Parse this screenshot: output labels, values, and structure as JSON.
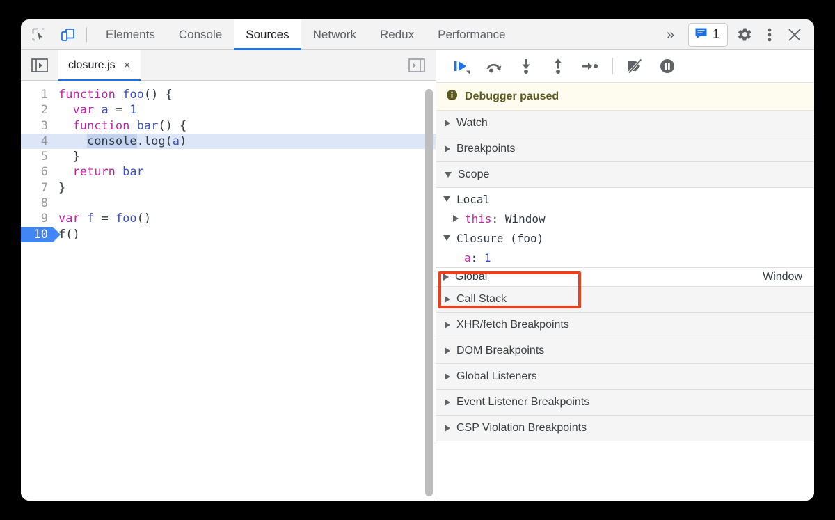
{
  "window": {
    "tabbar": {
      "inspect_icon": "inspect-element-icon",
      "device_icon": "device-toolbar-icon",
      "tabs": [
        {
          "label": "Elements",
          "active": false
        },
        {
          "label": "Console",
          "active": false
        },
        {
          "label": "Sources",
          "active": true
        },
        {
          "label": "Network",
          "active": false
        },
        {
          "label": "Redux",
          "active": false
        },
        {
          "label": "Performance",
          "active": false
        }
      ],
      "more_tabs_label": "»",
      "message_badge": {
        "icon": "message-bubble-icon",
        "count": "1"
      },
      "settings_icon": "gear-icon",
      "more_options_icon": "kebab-menu-icon",
      "close_icon": "close-icon"
    }
  },
  "editor": {
    "navigator_toggle_icon": "show-navigator-icon",
    "debugger_toggle_icon": "show-debugger-icon",
    "file_tab": {
      "name": "closure.js",
      "close_label": "×"
    },
    "lines": [
      {
        "n": "1",
        "breakpoint": false,
        "executing": false,
        "tokens": [
          {
            "t": "function",
            "c": "kw"
          },
          {
            "t": " ",
            "c": ""
          },
          {
            "t": "foo",
            "c": "fn"
          },
          {
            "t": "() {",
            "c": ""
          }
        ]
      },
      {
        "n": "2",
        "breakpoint": false,
        "executing": false,
        "tokens": [
          {
            "t": "  ",
            "c": ""
          },
          {
            "t": "var",
            "c": "kw"
          },
          {
            "t": " ",
            "c": ""
          },
          {
            "t": "a",
            "c": "vr"
          },
          {
            "t": " = ",
            "c": ""
          },
          {
            "t": "1",
            "c": "num"
          }
        ]
      },
      {
        "n": "3",
        "breakpoint": false,
        "executing": false,
        "tokens": [
          {
            "t": "  ",
            "c": ""
          },
          {
            "t": "function",
            "c": "kw"
          },
          {
            "t": " ",
            "c": ""
          },
          {
            "t": "bar",
            "c": "fn"
          },
          {
            "t": "() {",
            "c": ""
          }
        ]
      },
      {
        "n": "4",
        "breakpoint": false,
        "executing": true,
        "tokens": [
          {
            "t": "    ",
            "c": ""
          },
          {
            "t": "console",
            "c": "sel"
          },
          {
            "t": ".log(",
            "c": ""
          },
          {
            "t": "a",
            "c": "vr"
          },
          {
            "t": ")",
            "c": ""
          }
        ]
      },
      {
        "n": "5",
        "breakpoint": false,
        "executing": false,
        "tokens": [
          {
            "t": "  }",
            "c": ""
          }
        ]
      },
      {
        "n": "6",
        "breakpoint": false,
        "executing": false,
        "tokens": [
          {
            "t": "  ",
            "c": ""
          },
          {
            "t": "return",
            "c": "kw"
          },
          {
            "t": " ",
            "c": ""
          },
          {
            "t": "bar",
            "c": "fn"
          }
        ]
      },
      {
        "n": "7",
        "breakpoint": false,
        "executing": false,
        "tokens": [
          {
            "t": "}",
            "c": ""
          }
        ]
      },
      {
        "n": "8",
        "breakpoint": false,
        "executing": false,
        "tokens": []
      },
      {
        "n": "9",
        "breakpoint": false,
        "executing": false,
        "tokens": [
          {
            "t": "var",
            "c": "kw"
          },
          {
            "t": " ",
            "c": ""
          },
          {
            "t": "f",
            "c": "vr"
          },
          {
            "t": " = ",
            "c": ""
          },
          {
            "t": "foo",
            "c": "fn"
          },
          {
            "t": "()",
            "c": ""
          }
        ]
      },
      {
        "n": "10",
        "breakpoint": true,
        "executing": false,
        "tokens": [
          {
            "t": "f()",
            "c": ""
          }
        ]
      }
    ]
  },
  "debugger": {
    "toolbar_buttons": [
      {
        "name": "resume-script-execution-icon",
        "active": true
      },
      {
        "name": "step-over-next-function-call-icon",
        "active": false
      },
      {
        "name": "step-into-next-function-call-icon",
        "active": false
      },
      {
        "name": "step-out-of-current-function-icon",
        "active": false
      },
      {
        "name": "step-icon",
        "active": false
      },
      {
        "name": "deactivate-breakpoints-icon",
        "active": false
      },
      {
        "name": "pause-on-exceptions-icon",
        "active": false
      }
    ],
    "paused_banner": {
      "icon": "info-icon",
      "text": "Debugger paused"
    },
    "sections": [
      {
        "label": "Watch",
        "expanded": false
      },
      {
        "label": "Breakpoints",
        "expanded": false
      },
      {
        "label": "Scope",
        "expanded": true
      }
    ],
    "scope": {
      "local": {
        "label": "Local",
        "expanded": true,
        "properties": [
          {
            "name": "this",
            "separator": ": ",
            "value": "Window",
            "value_kind": "obj",
            "expandable": true
          }
        ]
      },
      "closure": {
        "label": "Closure (foo)",
        "expanded": true,
        "highlighted": true,
        "properties": [
          {
            "name": "a",
            "separator": ": ",
            "value": "1",
            "value_kind": "num",
            "expandable": false
          }
        ]
      },
      "global": {
        "label": "Global",
        "value": "Window",
        "expanded": false
      }
    },
    "bottom_sections": [
      {
        "label": "Call Stack",
        "expanded": false
      },
      {
        "label": "XHR/fetch Breakpoints",
        "expanded": false
      },
      {
        "label": "DOM Breakpoints",
        "expanded": false
      },
      {
        "label": "Global Listeners",
        "expanded": false
      },
      {
        "label": "Event Listener Breakpoints",
        "expanded": false
      },
      {
        "label": "CSP Violation Breakpoints",
        "expanded": false
      }
    ]
  },
  "colors": {
    "accent": "#1a73e8",
    "breakpoint": "#4285f4",
    "exec_line": "#dce6f7",
    "annotation_box": "#e8401f",
    "paused_banner_bg": "#fdfcef",
    "paused_banner_text": "#5c5a1e",
    "keyword": "#c026a6",
    "number": "#2942cc",
    "function_name": "#3f51b5"
  }
}
